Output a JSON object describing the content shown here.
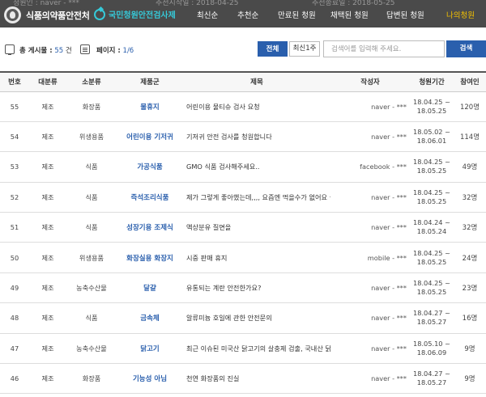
{
  "header": {
    "bg_text": {
      "proposer": "청원인 : naver - ***",
      "start": "추천시작일 : 2018-04-25",
      "end": "추천종료일 : 2018-05-25"
    },
    "logo_text": "식품의약품안전처",
    "campaign": "국민청원안전검사제",
    "nav": [
      "최신순",
      "추천순",
      "만료된 청원",
      "채택된 청원",
      "답변된 청원",
      "나의청원"
    ],
    "active_color": "#f5c200"
  },
  "toolbar": {
    "total_label": "총 게시물 :",
    "total_value": "55",
    "total_unit": "건",
    "page_label": "페이지 :",
    "page_value": "1/6",
    "btn_all": "전체",
    "btn_week": "최신1주",
    "search_placeholder": "검색어를 입력해 주세요.",
    "search_button": "검색"
  },
  "table": {
    "headers": [
      "번호",
      "대분류",
      "소분류",
      "제품군",
      "제목",
      "작성자",
      "청원기간",
      "참여인"
    ],
    "rows": [
      {
        "no": "55",
        "cat": "제조",
        "sub": "화장품",
        "group": "물휴지",
        "title": "어린이용 물티슈 검사 요청",
        "author": "naver - ***",
        "p1": "18.04.25 ~",
        "p2": "18.05.25",
        "count": "120명"
      },
      {
        "no": "54",
        "cat": "제조",
        "sub": "위생용품",
        "group": "어린이용 기저귀",
        "title": "기저귀 안전 검사를 청원합니다",
        "author": "naver - ***",
        "p1": "18.05.02 ~",
        "p2": "18.06.01",
        "count": "114명"
      },
      {
        "no": "53",
        "cat": "제조",
        "sub": "식품",
        "group": "가공식품",
        "title": "GMO 식품 검사해주세요..",
        "author": "facebook - ***",
        "p1": "18.04.25 ~",
        "p2": "18.05.25",
        "count": "49명"
      },
      {
        "no": "52",
        "cat": "제조",
        "sub": "식품",
        "group": "즉석조리식품",
        "title": "제가 그렇게 좋아했는데,,,, 요즘엔 먹을수가 없어요 ㅠㅠ",
        "author": "naver - ***",
        "p1": "18.04.25 ~",
        "p2": "18.05.25",
        "count": "32명"
      },
      {
        "no": "51",
        "cat": "제조",
        "sub": "식품",
        "group": "성장기용 조제식",
        "title": "액상분유 질면을",
        "author": "naver - ***",
        "p1": "18.04.24 ~",
        "p2": "18.05.24",
        "count": "32명"
      },
      {
        "no": "50",
        "cat": "제조",
        "sub": "위생용품",
        "group": "화장실용 화장지",
        "title": "시중 판매 휴지",
        "author": "mobile - ***",
        "p1": "18.04.25 ~",
        "p2": "18.05.25",
        "count": "24명"
      },
      {
        "no": "49",
        "cat": "제조",
        "sub": "농축수산물",
        "group": "달걀",
        "title": "유통되는 계란 안전한가요?",
        "author": "naver - ***",
        "p1": "18.04.25 ~",
        "p2": "18.05.25",
        "count": "23명"
      },
      {
        "no": "48",
        "cat": "제조",
        "sub": "식품",
        "group": "금속체",
        "title": "알류미늄 호일에 관한 안전문의",
        "author": "naver - ***",
        "p1": "18.04.27 ~",
        "p2": "18.05.27",
        "count": "16명"
      },
      {
        "no": "47",
        "cat": "제조",
        "sub": "농축수산물",
        "group": "닭고기",
        "title": "최근 이슈된 미국산 닭고기의 살충제 검출, 국내산 닭고기...",
        "author": "naver - ***",
        "p1": "18.05.10 ~",
        "p2": "18.06.09",
        "count": "9명"
      },
      {
        "no": "46",
        "cat": "제조",
        "sub": "화장품",
        "group": "기능성 아님",
        "title": "천연 화장품의 진실",
        "author": "naver - ***",
        "p1": "18.04.27 ~",
        "p2": "18.05.27",
        "count": "9명"
      }
    ]
  }
}
